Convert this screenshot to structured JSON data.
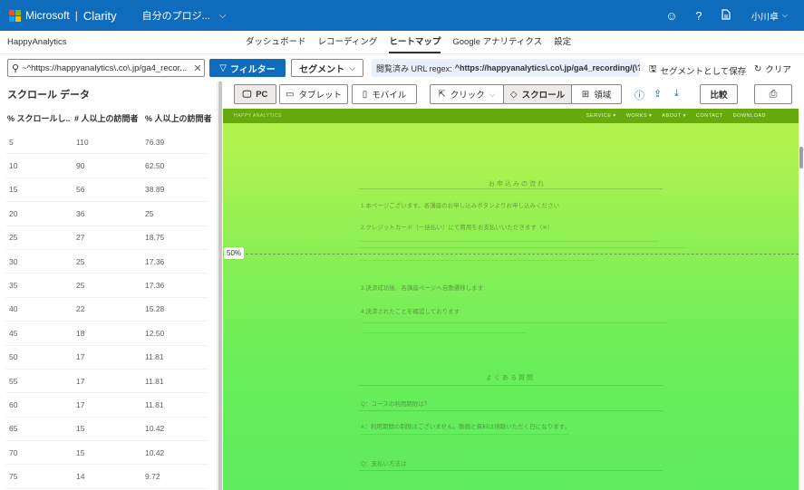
{
  "topbar": {
    "brand": "Microsoft",
    "product": "Clarity",
    "project": "自分のプロジ...",
    "user": "小川卓",
    "icons": [
      "smiley-icon",
      "help-icon",
      "document-icon"
    ]
  },
  "nav": {
    "site_name": "HappyAnalytics",
    "tabs": [
      "ダッシュボード",
      "レコーディング",
      "ヒートマップ",
      "Google アナリティクス",
      "設定"
    ],
    "active_tab": "ヒートマップ"
  },
  "filter": {
    "search_value": "~^https://happyanalytics\\.co\\.jp/ga4_recor...",
    "filter_label": "フィルター",
    "segment_label": "セグメント",
    "url_prefix": "閲覧済み URL regex:",
    "url_value": "^https://happyanalytics\\.co\\.jp/ga4_recording/(\\?",
    "save_segment": "セグメントとして保存",
    "clear": "クリア"
  },
  "scroll_panel": {
    "title": "スクロール データ",
    "columns": [
      "% スクロールし...",
      "# 人以上の訪問者",
      "% 人以上の訪問者"
    ],
    "rows": [
      [
        "5",
        "110",
        "76.39"
      ],
      [
        "10",
        "90",
        "62.50"
      ],
      [
        "15",
        "56",
        "38.89"
      ],
      [
        "20",
        "36",
        "25"
      ],
      [
        "25",
        "27",
        "18.75"
      ],
      [
        "30",
        "25",
        "17.36"
      ],
      [
        "35",
        "25",
        "17.36"
      ],
      [
        "40",
        "22",
        "15.28"
      ],
      [
        "45",
        "18",
        "12.50"
      ],
      [
        "50",
        "17",
        "11.81"
      ],
      [
        "55",
        "17",
        "11.81"
      ],
      [
        "60",
        "17",
        "11.81"
      ],
      [
        "65",
        "15",
        "10.42"
      ],
      [
        "70",
        "15",
        "10.42"
      ],
      [
        "75",
        "14",
        "9.72"
      ]
    ]
  },
  "toolbar": {
    "pc": "PC",
    "tablet": "タブレット",
    "mobile": "モバイル",
    "click": "クリック",
    "scroll": "スクロール",
    "area": "領域",
    "compare": "比較"
  },
  "heatmap": {
    "fold_label": "50%",
    "site_links": [
      "SERVICE ▾",
      "WORKS ▾",
      "ABOUT ▾",
      "CONTACT",
      "DOWNLOAD"
    ],
    "site_logo": "HAPPY ANALYTICS",
    "heading1": "お申込みの流れ",
    "heading2": "よくある質問",
    "lines": [
      "1.本ページございます。各講座のお申し込みボタンよりお申し込みください",
      "2.クレジットカード（一括払い）にて費用をお支払いいただきます（※）",
      "3.決済成功後、各講座ページへ自動遷移します",
      "4.決済されたことを確認しております",
      "Q：コースの利用期限は？",
      "A：利用期間の制限はございません。動画と資料は視聴いただく日になります。",
      "Q：支払い方法は"
    ]
  }
}
